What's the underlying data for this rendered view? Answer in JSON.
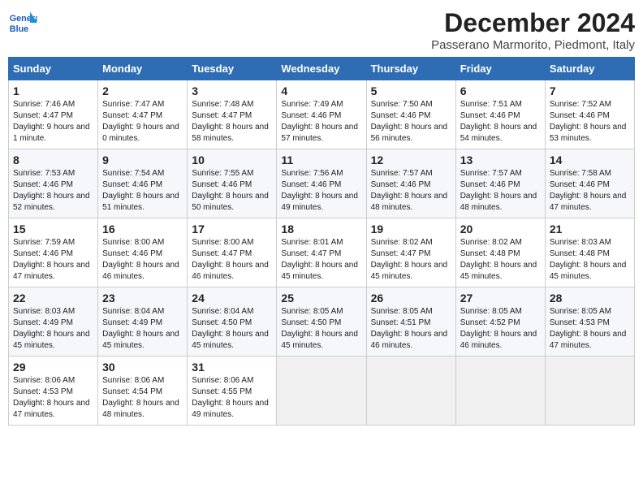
{
  "header": {
    "logo_general": "General",
    "logo_blue": "Blue",
    "month": "December 2024",
    "location": "Passerano Marmorito, Piedmont, Italy"
  },
  "weekdays": [
    "Sunday",
    "Monday",
    "Tuesday",
    "Wednesday",
    "Thursday",
    "Friday",
    "Saturday"
  ],
  "weeks": [
    [
      {
        "day": "1",
        "sunrise": "Sunrise: 7:46 AM",
        "sunset": "Sunset: 4:47 PM",
        "daylight": "Daylight: 9 hours and 1 minute."
      },
      {
        "day": "2",
        "sunrise": "Sunrise: 7:47 AM",
        "sunset": "Sunset: 4:47 PM",
        "daylight": "Daylight: 9 hours and 0 minutes."
      },
      {
        "day": "3",
        "sunrise": "Sunrise: 7:48 AM",
        "sunset": "Sunset: 4:47 PM",
        "daylight": "Daylight: 8 hours and 58 minutes."
      },
      {
        "day": "4",
        "sunrise": "Sunrise: 7:49 AM",
        "sunset": "Sunset: 4:46 PM",
        "daylight": "Daylight: 8 hours and 57 minutes."
      },
      {
        "day": "5",
        "sunrise": "Sunrise: 7:50 AM",
        "sunset": "Sunset: 4:46 PM",
        "daylight": "Daylight: 8 hours and 56 minutes."
      },
      {
        "day": "6",
        "sunrise": "Sunrise: 7:51 AM",
        "sunset": "Sunset: 4:46 PM",
        "daylight": "Daylight: 8 hours and 54 minutes."
      },
      {
        "day": "7",
        "sunrise": "Sunrise: 7:52 AM",
        "sunset": "Sunset: 4:46 PM",
        "daylight": "Daylight: 8 hours and 53 minutes."
      }
    ],
    [
      {
        "day": "8",
        "sunrise": "Sunrise: 7:53 AM",
        "sunset": "Sunset: 4:46 PM",
        "daylight": "Daylight: 8 hours and 52 minutes."
      },
      {
        "day": "9",
        "sunrise": "Sunrise: 7:54 AM",
        "sunset": "Sunset: 4:46 PM",
        "daylight": "Daylight: 8 hours and 51 minutes."
      },
      {
        "day": "10",
        "sunrise": "Sunrise: 7:55 AM",
        "sunset": "Sunset: 4:46 PM",
        "daylight": "Daylight: 8 hours and 50 minutes."
      },
      {
        "day": "11",
        "sunrise": "Sunrise: 7:56 AM",
        "sunset": "Sunset: 4:46 PM",
        "daylight": "Daylight: 8 hours and 49 minutes."
      },
      {
        "day": "12",
        "sunrise": "Sunrise: 7:57 AM",
        "sunset": "Sunset: 4:46 PM",
        "daylight": "Daylight: 8 hours and 48 minutes."
      },
      {
        "day": "13",
        "sunrise": "Sunrise: 7:57 AM",
        "sunset": "Sunset: 4:46 PM",
        "daylight": "Daylight: 8 hours and 48 minutes."
      },
      {
        "day": "14",
        "sunrise": "Sunrise: 7:58 AM",
        "sunset": "Sunset: 4:46 PM",
        "daylight": "Daylight: 8 hours and 47 minutes."
      }
    ],
    [
      {
        "day": "15",
        "sunrise": "Sunrise: 7:59 AM",
        "sunset": "Sunset: 4:46 PM",
        "daylight": "Daylight: 8 hours and 47 minutes."
      },
      {
        "day": "16",
        "sunrise": "Sunrise: 8:00 AM",
        "sunset": "Sunset: 4:46 PM",
        "daylight": "Daylight: 8 hours and 46 minutes."
      },
      {
        "day": "17",
        "sunrise": "Sunrise: 8:00 AM",
        "sunset": "Sunset: 4:47 PM",
        "daylight": "Daylight: 8 hours and 46 minutes."
      },
      {
        "day": "18",
        "sunrise": "Sunrise: 8:01 AM",
        "sunset": "Sunset: 4:47 PM",
        "daylight": "Daylight: 8 hours and 45 minutes."
      },
      {
        "day": "19",
        "sunrise": "Sunrise: 8:02 AM",
        "sunset": "Sunset: 4:47 PM",
        "daylight": "Daylight: 8 hours and 45 minutes."
      },
      {
        "day": "20",
        "sunrise": "Sunrise: 8:02 AM",
        "sunset": "Sunset: 4:48 PM",
        "daylight": "Daylight: 8 hours and 45 minutes."
      },
      {
        "day": "21",
        "sunrise": "Sunrise: 8:03 AM",
        "sunset": "Sunset: 4:48 PM",
        "daylight": "Daylight: 8 hours and 45 minutes."
      }
    ],
    [
      {
        "day": "22",
        "sunrise": "Sunrise: 8:03 AM",
        "sunset": "Sunset: 4:49 PM",
        "daylight": "Daylight: 8 hours and 45 minutes."
      },
      {
        "day": "23",
        "sunrise": "Sunrise: 8:04 AM",
        "sunset": "Sunset: 4:49 PM",
        "daylight": "Daylight: 8 hours and 45 minutes."
      },
      {
        "day": "24",
        "sunrise": "Sunrise: 8:04 AM",
        "sunset": "Sunset: 4:50 PM",
        "daylight": "Daylight: 8 hours and 45 minutes."
      },
      {
        "day": "25",
        "sunrise": "Sunrise: 8:05 AM",
        "sunset": "Sunset: 4:50 PM",
        "daylight": "Daylight: 8 hours and 45 minutes."
      },
      {
        "day": "26",
        "sunrise": "Sunrise: 8:05 AM",
        "sunset": "Sunset: 4:51 PM",
        "daylight": "Daylight: 8 hours and 46 minutes."
      },
      {
        "day": "27",
        "sunrise": "Sunrise: 8:05 AM",
        "sunset": "Sunset: 4:52 PM",
        "daylight": "Daylight: 8 hours and 46 minutes."
      },
      {
        "day": "28",
        "sunrise": "Sunrise: 8:05 AM",
        "sunset": "Sunset: 4:53 PM",
        "daylight": "Daylight: 8 hours and 47 minutes."
      }
    ],
    [
      {
        "day": "29",
        "sunrise": "Sunrise: 8:06 AM",
        "sunset": "Sunset: 4:53 PM",
        "daylight": "Daylight: 8 hours and 47 minutes."
      },
      {
        "day": "30",
        "sunrise": "Sunrise: 8:06 AM",
        "sunset": "Sunset: 4:54 PM",
        "daylight": "Daylight: 8 hours and 48 minutes."
      },
      {
        "day": "31",
        "sunrise": "Sunrise: 8:06 AM",
        "sunset": "Sunset: 4:55 PM",
        "daylight": "Daylight: 8 hours and 49 minutes."
      },
      null,
      null,
      null,
      null
    ]
  ]
}
